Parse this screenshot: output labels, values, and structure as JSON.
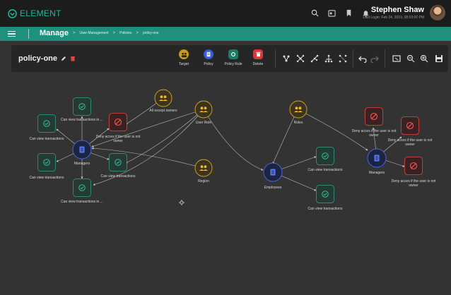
{
  "app": {
    "brand": "ELEMENT",
    "accent": "#1fb7a0"
  },
  "header": {
    "user_name": "Stephen Shaw",
    "last_login": "Last Login: Feb 24, 2019, 08:03:00 PM"
  },
  "nav": {
    "section": "Manage",
    "breadcrumbs": [
      "User Management",
      "Policies",
      "policy-one"
    ]
  },
  "toolbar": {
    "policy_name": "policy-one",
    "buttons": [
      {
        "label": "Target",
        "icon": "target-group-icon",
        "color": "#c99a1a"
      },
      {
        "label": "Policy",
        "icon": "policy-icon",
        "color": "#3b5bd6"
      },
      {
        "label": "Policy Rule",
        "icon": "policy-rule-icon",
        "color": "#1f7a68"
      },
      {
        "label": "Delete",
        "icon": "trash-icon",
        "color": "#d83a3a"
      }
    ]
  },
  "graph": {
    "nodes": [
      {
        "id": "n-allow-1",
        "type": "allow",
        "label": "Can view transactions in ..."
      },
      {
        "id": "n-allow-2",
        "type": "allow",
        "label": "Can view transactions"
      },
      {
        "id": "n-deny-1",
        "type": "deny",
        "label": "Deny acces if the user is not owner"
      },
      {
        "id": "n-all-except",
        "type": "group",
        "label": "All except owners"
      },
      {
        "id": "n-user-role",
        "type": "group",
        "label": "User Role"
      },
      {
        "id": "n-managers-1",
        "type": "policy",
        "label": "Managers"
      },
      {
        "id": "n-allow-3",
        "type": "allow",
        "label": "Can view transactions"
      },
      {
        "id": "n-allow-4",
        "type": "allow",
        "label": "Can view transactions"
      },
      {
        "id": "n-allow-5",
        "type": "allow",
        "label": "Can view transactions in ..."
      },
      {
        "id": "n-region",
        "type": "group",
        "label": "Region"
      },
      {
        "id": "n-roles",
        "type": "group",
        "label": "Roles"
      },
      {
        "id": "n-employees",
        "type": "policy",
        "label": "Employees"
      },
      {
        "id": "n-allow-6",
        "type": "allow",
        "label": "Can view transactions"
      },
      {
        "id": "n-allow-7",
        "type": "allow",
        "label": "Can view transactions"
      },
      {
        "id": "n-deny-2",
        "type": "deny",
        "label": "Deny acces if the user is not owner"
      },
      {
        "id": "n-deny-3",
        "type": "deny",
        "label": "Deny acces if the user is not owner"
      },
      {
        "id": "n-managers-2",
        "type": "policy",
        "label": "Managers"
      },
      {
        "id": "n-deny-4",
        "type": "deny",
        "label": "Deny acces if the user is not owner"
      }
    ]
  }
}
